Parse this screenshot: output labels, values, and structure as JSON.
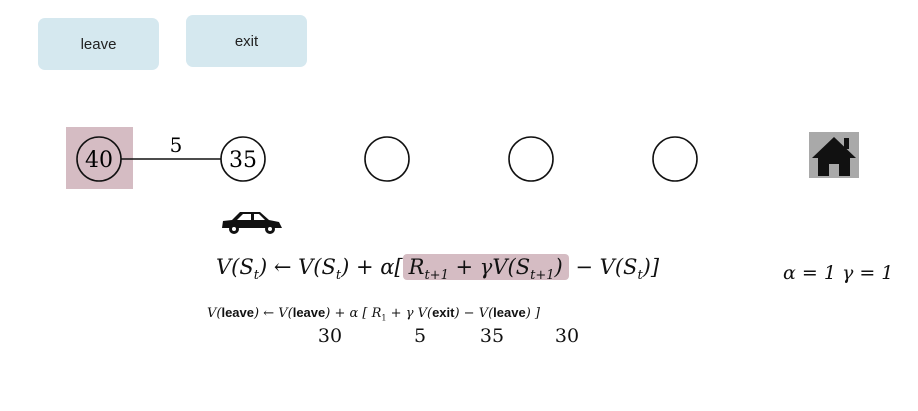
{
  "buttons": {
    "leave": "leave",
    "exit": "exit"
  },
  "edge_reward": "5",
  "states": [
    {
      "value": "40",
      "highlighted": true
    },
    {
      "value": "35",
      "highlighted": false
    },
    {
      "value": "",
      "highlighted": false
    },
    {
      "value": "",
      "highlighted": false
    },
    {
      "value": "",
      "highlighted": false
    }
  ],
  "icons": [
    "car-icon",
    "home-icon"
  ],
  "colors": {
    "button": "#d5e8ef",
    "highlight": "#d5bcc3",
    "home_bg": "#a9a9a9"
  },
  "equation": {
    "lhs": "V(S",
    "t": "t",
    "arrow_rhs": ") ← V(S",
    "plus_alpha": ") + α[",
    "R": "R",
    "t1": "t+1",
    "gamma": " + γV(S",
    "close_hl": ")",
    "minus": " − V(S",
    "end": ")]",
    "params": "α = 1  γ = 1"
  },
  "sub_equation": {
    "v1": "V(",
    "leave": "leave",
    "arrow": ") ← V(",
    "plus": ") + α  [  R",
    "one": "1",
    "gamma": " + γ  V(",
    "exit": "exit",
    "minus": ") − V(",
    "end": ") ]"
  },
  "numbers": [
    "30",
    "5",
    "35",
    "30"
  ]
}
